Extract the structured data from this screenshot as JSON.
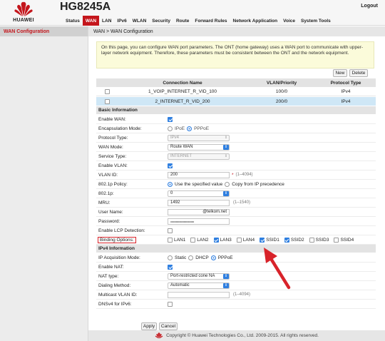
{
  "brand": {
    "logo_text": "HUAWEI",
    "model": "HG8245A",
    "red": "#c4161c",
    "accent_blue": "#2f7fe0"
  },
  "header": {
    "logout_label": "Logout",
    "nav": [
      "Status",
      "WAN",
      "LAN",
      "IPv6",
      "WLAN",
      "Security",
      "Route",
      "Forward Rules",
      "Network Application",
      "Voice",
      "System Tools"
    ],
    "active_nav": "WAN"
  },
  "sidebar": {
    "items": [
      {
        "label": "WAN Configuration"
      }
    ]
  },
  "main": {
    "breadcrumb": "WAN > WAN Configuration",
    "note": "On this page, you can configure WAN port parameters. The ONT (home gateway) uses a WAN port to communicate with upper-layer network equipment. Therefore, these parameters must be consistent between the ONT and the network equipment.",
    "new_label": "New",
    "delete_label": "Delete",
    "apply_label": "Apply",
    "cancel_label": "Cancel"
  },
  "connections": {
    "headers": [
      "Connection Name",
      "VLAN/Priority",
      "Protocol Type"
    ],
    "rows": [
      {
        "name": "1_VOIP_INTERNET_R_VID_100",
        "vlan": "100/0",
        "protocol": "IPv4",
        "selected": false
      },
      {
        "name": "2_INTERNET_R_VID_200",
        "vlan": "200/0",
        "protocol": "IPv4",
        "selected": true
      }
    ]
  },
  "basic": {
    "title": "Basic Information",
    "labels": {
      "enable_wan": "Enable WAN:",
      "encapsulation": "Encapsulation Mode:",
      "protocol_type": "Protocol Type:",
      "wan_mode": "WAN Mode:",
      "service_type": "Service Type:",
      "enable_vlan": "Enable VLAN:",
      "vlan_id": "VLAN ID:",
      "p8021_policy": "802.1p Policy:",
      "p8021": "802.1p:",
      "mru": "MRU:",
      "username": "User Name:",
      "password": "Password:",
      "lcp": "Enable LCP Detection:",
      "binding": "Binding Options:"
    },
    "values": {
      "encap_ipoe": "IPoE",
      "encap_pppoe": "PPPoE",
      "protocol_type": "IPv4",
      "wan_mode": "Route WAN",
      "service_type": "INTERNET",
      "vlan_id": "200",
      "vlan_hint": "(1–4094)",
      "vlan_req": "*",
      "policy_specified": "Use the specified value",
      "policy_copy": "Copy from IP precedence",
      "p8021": "0",
      "mru": "1492",
      "mru_hint": "(1–1540)",
      "username": "@telkom.net",
      "password": "••••••••••••••••••••••••••••••"
    },
    "binding_options": [
      {
        "label": "LAN1",
        "checked": false
      },
      {
        "label": "LAN2",
        "checked": false
      },
      {
        "label": "LAN3",
        "checked": true
      },
      {
        "label": "LAN4",
        "checked": false
      },
      {
        "label": "SSID1",
        "checked": true
      },
      {
        "label": "SSID2",
        "checked": true
      },
      {
        "label": "SSID3",
        "checked": false
      },
      {
        "label": "SSID4",
        "checked": false
      }
    ]
  },
  "ipv4": {
    "title": "IPv4 Information",
    "labels": {
      "acquisition": "IP Acquisition Mode:",
      "nat": "Enable NAT:",
      "nat_type": "NAT type:",
      "dialing": "Dialing Method:",
      "multicast": "Multicast VLAN ID:",
      "dnsv4": "DNSv4 for IPv6:"
    },
    "values": {
      "acq_static": "Static",
      "acq_dhcp": "DHCP",
      "acq_pppoe": "PPPoE",
      "nat_type": "Port-restricted cone NA",
      "dialing": "Automatic",
      "multicast_hint": "(1–4094)"
    }
  },
  "footer": {
    "copyright": "Copyright © Huawei Technologies Co., Ltd. 2009-2015. All rights reserved."
  }
}
